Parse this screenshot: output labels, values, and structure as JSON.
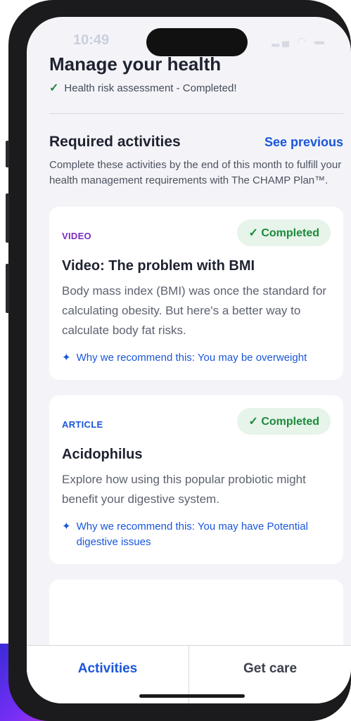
{
  "status": {
    "time": "10:49"
  },
  "header": {
    "title": "Manage your health",
    "assessment": "Health risk assessment - Completed!"
  },
  "required": {
    "title": "Required activities",
    "see_previous": "See previous",
    "description": "Complete these activities by the end of this month to fulfill your health management requirements with The CHAMP Plan™."
  },
  "cards": [
    {
      "type": "VIDEO",
      "type_color": "#7b2cbf",
      "status": "Completed",
      "title": "Video: The problem with BMI",
      "description": "Body mass index (BMI) was once the standard for calculating obesity. But here's a better way to calculate body fat risks.",
      "why": "Why we recommend this: You may be overweight"
    },
    {
      "type": "ARTICLE",
      "type_color": "#1a56db",
      "status": "Completed",
      "title": "Acidophilus",
      "description": "Explore how using this popular probiotic might benefit your digestive system.",
      "why": "Why we recommend this: You may have Potential digestive issues"
    }
  ],
  "tabs": [
    {
      "label": "Activities",
      "color": "#1a56db"
    },
    {
      "label": "Get care",
      "color": "#3a3f4b"
    }
  ]
}
